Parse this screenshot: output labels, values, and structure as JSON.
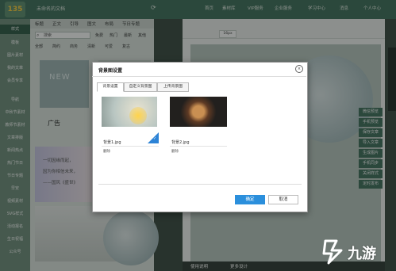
{
  "app": {
    "logo_text": "135",
    "doc_title": "未命名的文档",
    "top_nav": [
      "首页",
      "素材库",
      "VIP服务",
      "企业服务",
      "学习中心",
      "消息",
      "个人中心"
    ]
  },
  "sidebar": {
    "items": [
      "样式",
      "模板",
      "图片素材",
      "我的文章",
      "会员专享",
      "导航",
      "中秋节素材",
      "教师节素材",
      "文章排版",
      "新闻热点",
      "热门节日",
      "节日专题",
      "早安",
      "视频素材",
      "SVG样式",
      "活动报名",
      "生日祝福",
      "公众号"
    ]
  },
  "template_panel": {
    "tabs": [
      "标题",
      "正文",
      "引导",
      "图文",
      "布局",
      "节日专题"
    ],
    "search_placeholder": "搜索",
    "filters": [
      "免费",
      "热门",
      "最新",
      "其他"
    ],
    "subfilters": [
      "全部",
      "简约",
      "商务",
      "清新",
      "可爱",
      "复古"
    ],
    "card_new_text": "NEW",
    "card_label": "广告",
    "quote_lines": [
      "一切因缘而起，",
      "因为你相信未来，",
      "——国风《盛世》"
    ]
  },
  "editor": {
    "font_size": "16px",
    "bottom_bar": [
      "使用说明",
      "更多设计"
    ]
  },
  "right_menu": [
    "微信预览",
    "手机预览",
    "保存文章",
    "导入文章",
    "生成图片",
    "手机同步",
    "关闭样式",
    "定时发布"
  ],
  "dialog": {
    "title": "背景图设置",
    "close_icon": "×",
    "tabs": [
      "背景设置",
      "自定义背景图",
      "上传背景图"
    ],
    "images": [
      {
        "name": "背景1.jpg",
        "delete": "删除"
      },
      {
        "name": "背景2.jpg",
        "delete": "删除"
      }
    ],
    "ok": "确定",
    "cancel": "取消"
  },
  "watermark": {
    "text": "九游"
  },
  "colors": {
    "accent": "#2b8fdc",
    "brand_green": "#3e6f5c"
  }
}
